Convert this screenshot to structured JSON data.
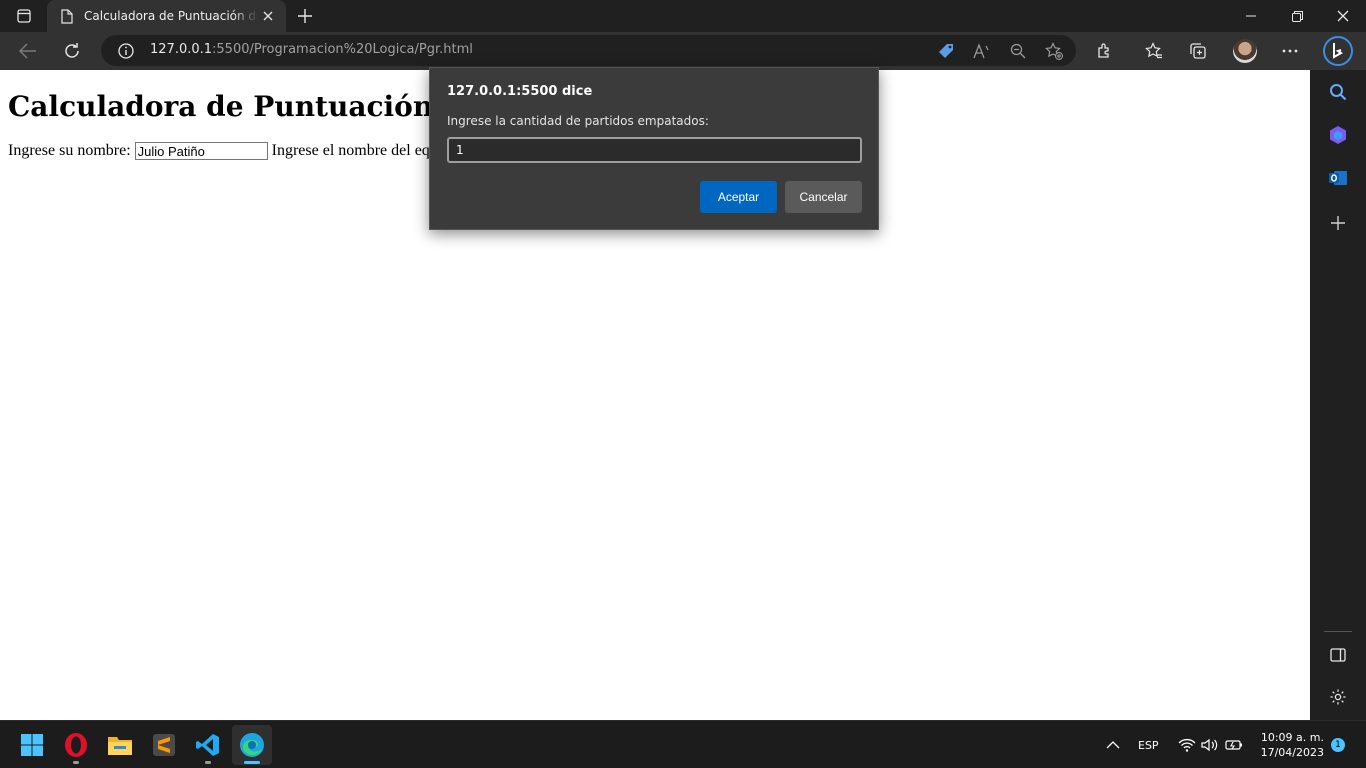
{
  "browser": {
    "tab_title": "Calculadora de Puntuación de Liga",
    "url_host": "127.0.0.1",
    "url_rest": ":5500/Programacion%20Logica/Pgr.html"
  },
  "page": {
    "title": "Calculadora de Puntuación de Liga",
    "name_label": "Ingrese su nombre:",
    "name_value": "Julio Patiño",
    "team_label": "Ingrese el nombre del equipo:",
    "team_value": ""
  },
  "dialog": {
    "title": "127.0.0.1:5500 dice",
    "message": "Ingrese la cantidad de partidos empatados:",
    "input_value": "1",
    "ok_label": "Aceptar",
    "cancel_label": "Cancelar"
  },
  "taskbar": {
    "apps": [
      "windows-start",
      "opera",
      "file-explorer",
      "sublime-text",
      "vs-code",
      "edge"
    ],
    "language": "ESP",
    "time": "10:09 a. m.",
    "date": "17/04/2023",
    "notification_count": "1"
  },
  "colors": {
    "accent": "#0067c0",
    "chrome_dark": "#202020",
    "chrome_mid": "#323232",
    "dialog_bg": "#3b3b3b"
  }
}
